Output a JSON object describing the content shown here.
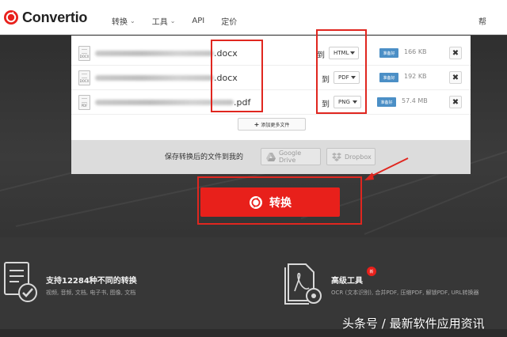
{
  "brand": {
    "name": "Convertio",
    "accent": "#e8201b"
  },
  "nav": {
    "items": [
      {
        "label": "转换",
        "has_dropdown": true
      },
      {
        "label": "工具",
        "has_dropdown": true
      },
      {
        "label": "API",
        "has_dropdown": false
      },
      {
        "label": "定价",
        "has_dropdown": false
      }
    ],
    "right_label": "帮"
  },
  "files": [
    {
      "icon_ext": "DOCX",
      "name_suffix": ".docx",
      "to_label": "到",
      "target_format": "HTML",
      "status": "准备好",
      "size": "166 KB"
    },
    {
      "icon_ext": "DOCX",
      "name_suffix": ".docx",
      "to_label": "到",
      "target_format": "PDF",
      "status": "准备好",
      "size": "192 KB"
    },
    {
      "icon_ext": "PDF",
      "name_suffix": ".pdf",
      "to_label": "到",
      "target_format": "PNG",
      "status": "准备好",
      "size": "57.4 MB"
    }
  ],
  "remove_glyph": "✖",
  "add_more": {
    "plus": "+",
    "label": "添加更多文件"
  },
  "save": {
    "label": "保存转换后的文件到我的",
    "google_drive": "Google Drive",
    "dropbox": "Dropbox"
  },
  "convert_button": {
    "label": "转换"
  },
  "features": [
    {
      "title": "支持12284种不同的转换",
      "desc": "视频, 音频, 文档, 电子书, 图像, 文档"
    },
    {
      "title": "高级工具",
      "badge": "新",
      "desc": "OCR (文本识别), 合并PDF, 压缩PDF, 解锁PDF, URL转换器"
    }
  ],
  "watermark": "头条号 / 最新软件应用资讯"
}
